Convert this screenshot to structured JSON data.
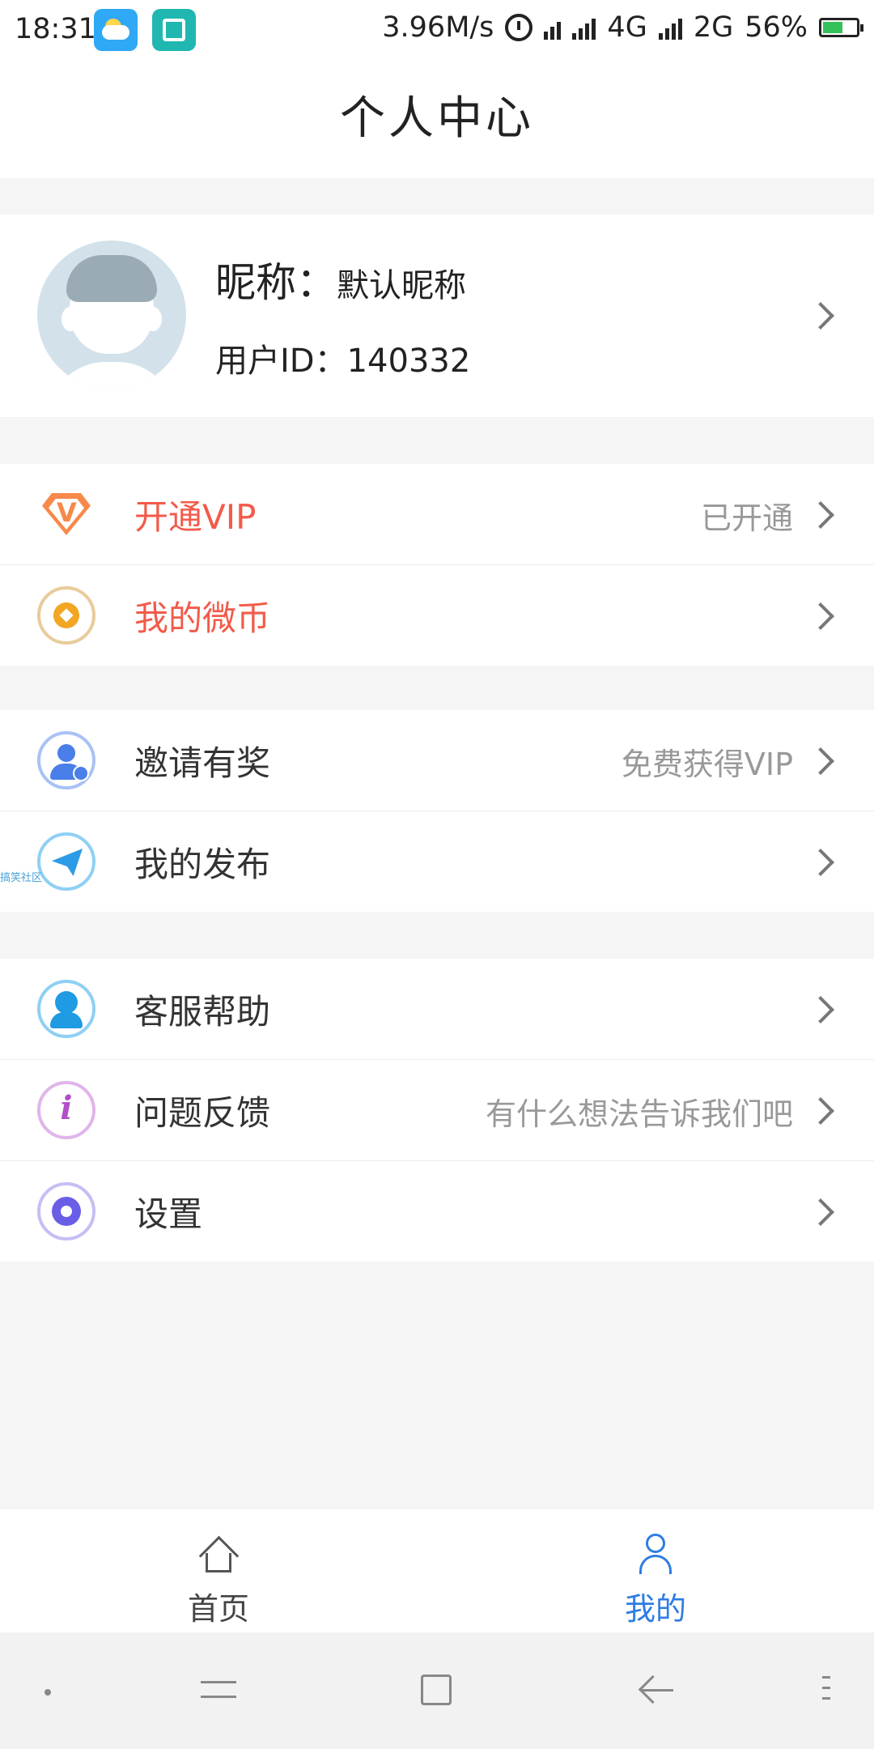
{
  "status_bar": {
    "time": "18:31",
    "net_speed": "3.96M/s",
    "net1": "4G",
    "net2": "2G",
    "battery": "56%"
  },
  "header": {
    "title": "个人中心"
  },
  "profile": {
    "nickname_label": "昵称：",
    "nickname_value": "默认昵称",
    "user_id_label": "用户ID：",
    "user_id_value": "140332"
  },
  "menu": {
    "group1": [
      {
        "label": "开通VIP",
        "hint": "已开通",
        "icon": "vip-diamond-icon"
      },
      {
        "label": "我的微币",
        "hint": "",
        "icon": "coin-icon"
      }
    ],
    "group2": [
      {
        "label": "邀请有奖",
        "hint": "免费获得VIP",
        "icon": "invite-user-icon"
      },
      {
        "label": "我的发布",
        "hint": "",
        "icon": "paper-plane-icon"
      }
    ],
    "group3": [
      {
        "label": "客服帮助",
        "hint": "",
        "icon": "customer-service-icon"
      },
      {
        "label": "问题反馈",
        "hint": "有什么想法告诉我们吧",
        "icon": "info-icon"
      },
      {
        "label": "设置",
        "hint": "",
        "icon": "gear-icon"
      }
    ]
  },
  "watermark": "搞笑社区",
  "tab_bar": {
    "home_label": "首页",
    "me_label": "我的",
    "active": "我的"
  },
  "colors": {
    "accent": "#2f7ce2",
    "vip_text": "#f25b4a",
    "hint": "#999999"
  }
}
